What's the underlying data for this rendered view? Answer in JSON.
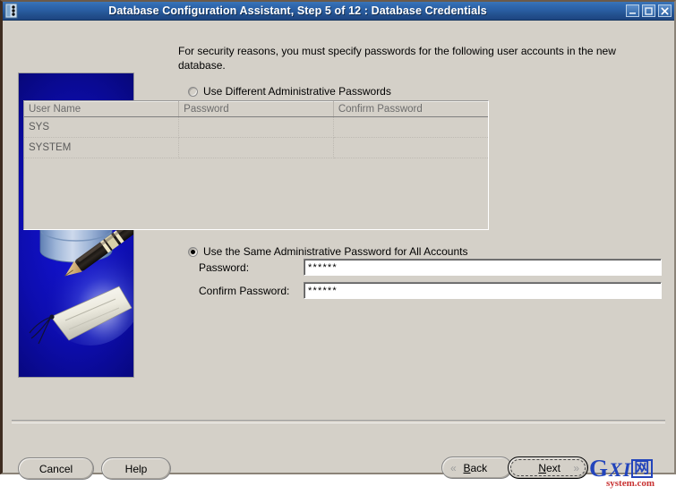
{
  "window": {
    "title": "Database Configuration Assistant, Step 5 of 12 : Database Credentials",
    "icon_name": "dbca-app-icon",
    "controls": {
      "minimize_label": "_",
      "maximize_label": "□",
      "close_label": "✕"
    },
    "colors": {
      "titlebar_start": "#3a74b8",
      "titlebar_end": "#1d4580",
      "client_bg": "#d4d0c8",
      "banner_blue": "#0d0dae",
      "watermark_blue": "#2244bb",
      "watermark_red": "#c83232"
    }
  },
  "banner": {
    "alt": "database cylinder with pen signing a tag"
  },
  "main": {
    "intro": "For security reasons, you must specify passwords for the following user accounts in the new database.",
    "options": [
      {
        "id": "different",
        "label": "Use Different Administrative Passwords",
        "selected": false
      },
      {
        "id": "same",
        "label": "Use the Same Administrative Password for All Accounts",
        "selected": true
      }
    ],
    "table": {
      "columns": [
        "User Name",
        "Password",
        "Confirm Password"
      ],
      "rows": [
        {
          "user_name": "SYS",
          "password": "",
          "confirm_password": ""
        },
        {
          "user_name": "SYSTEM",
          "password": "",
          "confirm_password": ""
        }
      ]
    },
    "fields": {
      "password": {
        "label": "Password:",
        "value": "******",
        "placeholder": ""
      },
      "confirm_password": {
        "label": "Confirm Password:",
        "value": "******",
        "placeholder": ""
      }
    }
  },
  "footer": {
    "cancel_label": "Cancel",
    "help_label": "Help",
    "back": {
      "label": "Back",
      "mnemonic": "B",
      "chevron": "«"
    },
    "next": {
      "label": "Next",
      "mnemonic": "N",
      "chevron": "»",
      "focused": true
    }
  },
  "watermark": {
    "letter_g": "G",
    "letters_xi": "XI",
    "cjk": "网",
    "sub": "system.com"
  }
}
